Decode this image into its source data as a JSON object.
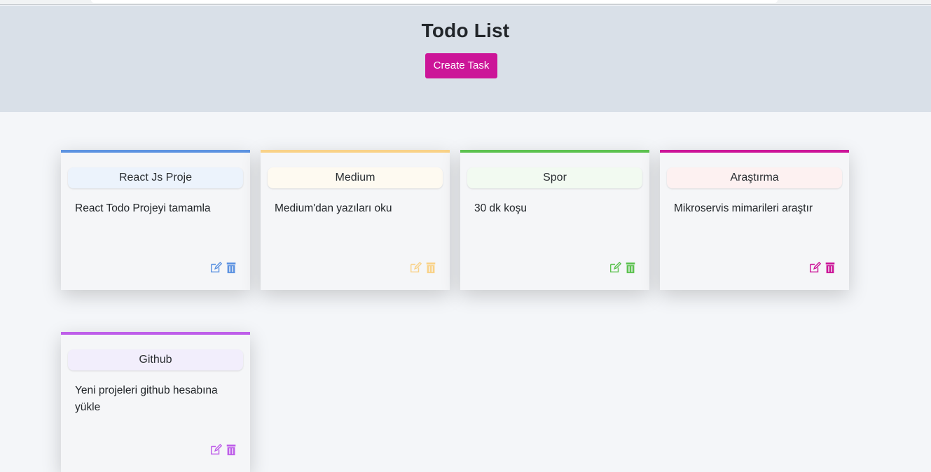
{
  "header": {
    "title": "Todo List",
    "create_button_label": "Create Task"
  },
  "cards": [
    {
      "title": "React Js Proje",
      "description": "React Todo Projeyi tamamla",
      "primary_color": "#5d93e1",
      "secondary_color": "#ecf3fc",
      "edit_icon": "edit-icon",
      "delete_icon": "trash-icon"
    },
    {
      "title": "Medium",
      "description": "Medium'dan yazıları oku",
      "primary_color": "#f9d288",
      "secondary_color": "#fefaf1",
      "edit_icon": "edit-icon",
      "delete_icon": "trash-icon"
    },
    {
      "title": "Spor",
      "description": "30 dk koşu",
      "primary_color": "#5dc250",
      "secondary_color": "#f2faf1",
      "edit_icon": "edit-icon",
      "delete_icon": "trash-icon"
    },
    {
      "title": "Araştırma",
      "description": "Mikroservis mimarileri araştır",
      "primary_color": "#cc1598",
      "secondary_color": "#fdf1f1",
      "edit_icon": "edit-icon",
      "delete_icon": "trash-icon"
    },
    {
      "title": "Github",
      "description": "Yeni projeleri github hesabına yükle",
      "primary_color": "#be5ee9",
      "secondary_color": "#f2eefc",
      "edit_icon": "edit-icon",
      "delete_icon": "trash-icon"
    }
  ]
}
